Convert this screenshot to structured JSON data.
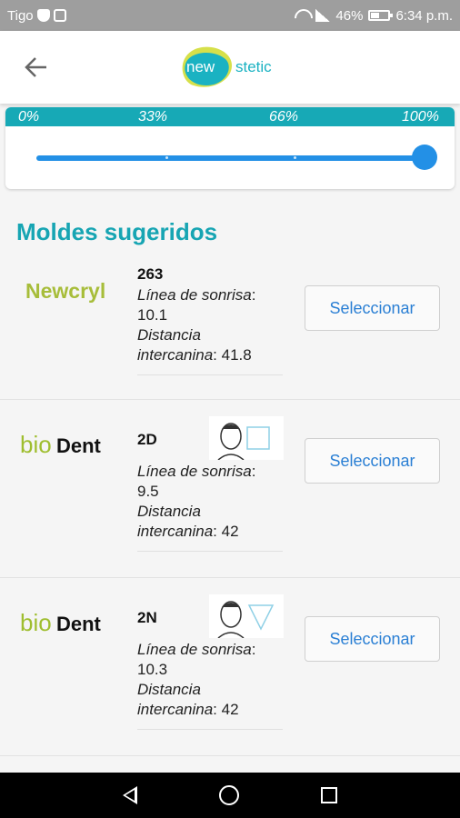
{
  "status_bar": {
    "carrier": "Tigo",
    "battery": "46%",
    "time": "6:34 p.m."
  },
  "header": {
    "logo_left": "new",
    "logo_right": "stetic"
  },
  "progress": {
    "ticks": [
      "0%",
      "33%",
      "66%",
      "100%"
    ],
    "value": 100
  },
  "section_title": "Moldes sugeridos",
  "items": [
    {
      "brand": "Newcryl",
      "code": "263",
      "smile_label": "Línea de sonrisa",
      "smile_value": "10.1",
      "dist_label_1": "Distancia",
      "dist_label_2": "intercanina",
      "dist_value": "41.8",
      "button": "Seleccionar",
      "face_shape": "none"
    },
    {
      "brand": "BioDent",
      "code": "2D",
      "smile_label": "Línea de sonrisa",
      "smile_value": "9.5",
      "dist_label_1": "Distancia",
      "dist_label_2": "intercanina",
      "dist_value": "42",
      "button": "Seleccionar",
      "face_shape": "square"
    },
    {
      "brand": "BioDent",
      "code": "2N",
      "smile_label": "Línea de sonrisa",
      "smile_value": "10.3",
      "dist_label_1": "Distancia",
      "dist_label_2": "intercanina",
      "dist_value": "42",
      "button": "Seleccionar",
      "face_shape": "triangle"
    }
  ],
  "colors": {
    "accent": "#17a9b6",
    "slider": "#2390e6",
    "button_text": "#2a7fd4"
  }
}
